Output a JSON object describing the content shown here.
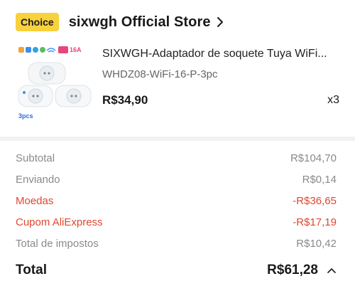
{
  "store": {
    "badge": "Choice",
    "name": "sixwgh Official Store",
    "chevron_icon": "chevron-right-icon"
  },
  "product": {
    "title": "SIXWGH-Adaptador de soquete Tuya WiFi...",
    "variant": "WHDZ08-WiFi-16-P-3pc",
    "price": "R$34,90",
    "quantity": "x3",
    "thumbnail": {
      "badge_text": "16A",
      "pack_label": "3pcs",
      "icons": [
        "wifi-icon",
        "tuya-icon",
        "smart-life-icon",
        "alexa-icon",
        "google-icon"
      ]
    }
  },
  "summary": {
    "rows": [
      {
        "label": "Subtotal",
        "value": "R$104,70",
        "style": "muted"
      },
      {
        "label": "Enviando",
        "value": "R$0,14",
        "style": "muted"
      },
      {
        "label": "Moedas",
        "value": "-R$36,65",
        "style": "red"
      },
      {
        "label": "Cupom AliExpress",
        "value": "-R$17,19",
        "style": "red"
      },
      {
        "label": "Total de impostos",
        "value": "R$10,42",
        "style": "muted"
      }
    ],
    "total_label": "Total",
    "total_value": "R$61,28",
    "expand_icon": "chevron-up-icon"
  },
  "colors": {
    "badge": "#f8d13c",
    "discount_red": "#e0472f",
    "muted_text": "#8a8a8a"
  }
}
